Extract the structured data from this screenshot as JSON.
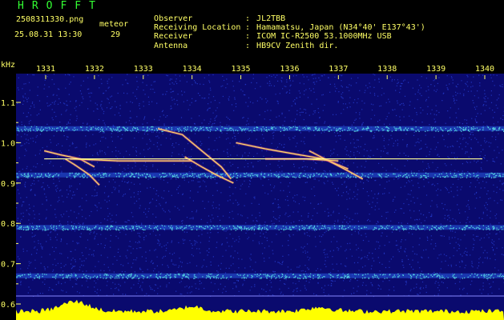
{
  "header": {
    "app_title": "HROFFT",
    "file_name": "2508311330.png",
    "meteor_label": "meteor",
    "datetime": "25.08.31 13:30",
    "meteor_count": "29"
  },
  "station_info": [
    {
      "key": "Observer",
      "sep": ":",
      "value": "JL2TBB"
    },
    {
      "key": "Receiving Location",
      "sep": ":",
      "value": "Hamamatsu, Japan (N34°40' E137°43')"
    },
    {
      "key": "Receiver",
      "sep": ":",
      "value": "ICOM IC-R2500 53.1000MHz USB"
    },
    {
      "key": "Antenna",
      "sep": ":",
      "value": "HB9CV Zenith dir."
    }
  ],
  "colors": {
    "background": "#0a0a6e",
    "text": "#ffff66",
    "title": "#33ff33",
    "carrier": "#ffff99",
    "signal_bar": "#ffff00",
    "noise": "#3355ff"
  },
  "chart_data": {
    "type": "heatmap",
    "y_unit_label": "kHz",
    "x_ticks": [
      "1331",
      "1332",
      "1333",
      "1334",
      "1335",
      "1336",
      "1337",
      "1338",
      "1339",
      "1340"
    ],
    "y_ticks": [
      "1.1",
      "1.0",
      "0.9",
      "0.8",
      "0.7",
      "0.6"
    ],
    "x_range": [
      1330.8,
      1340.2
    ],
    "y_range": [
      0.6,
      1.2
    ],
    "carrier_frequency": 0.96,
    "noise_bands": [
      1.035,
      0.92,
      0.79,
      0.67
    ],
    "meteor_traces": [
      {
        "t": [
          1330.97,
          1331.3,
          1331.7,
          1332.0
        ],
        "f": [
          0.98,
          0.97,
          0.96,
          0.94
        ]
      },
      {
        "t": [
          1331.4,
          1331.6,
          1331.9,
          1332.1
        ],
        "f": [
          0.96,
          0.945,
          0.92,
          0.895
        ]
      },
      {
        "t": [
          1331.5,
          1332.5,
          1333.3,
          1334.0
        ],
        "f": [
          0.96,
          0.955,
          0.955,
          0.955
        ]
      },
      {
        "t": [
          1333.3,
          1333.8,
          1334.2,
          1334.6,
          1334.8
        ],
        "f": [
          1.035,
          1.02,
          0.98,
          0.94,
          0.91
        ]
      },
      {
        "t": [
          1333.85,
          1334.2,
          1334.5,
          1334.85
        ],
        "f": [
          0.965,
          0.94,
          0.92,
          0.9
        ]
      },
      {
        "t": [
          1334.9,
          1335.5,
          1336.2,
          1336.7,
          1337.2
        ],
        "f": [
          1.0,
          0.985,
          0.97,
          0.96,
          0.935
        ]
      },
      {
        "t": [
          1336.4,
          1336.8,
          1337.2,
          1337.5
        ],
        "f": [
          0.98,
          0.955,
          0.93,
          0.91
        ]
      },
      {
        "t": [
          1335.5,
          1336.3,
          1337.0
        ],
        "f": [
          0.96,
          0.96,
          0.955
        ]
      }
    ]
  }
}
